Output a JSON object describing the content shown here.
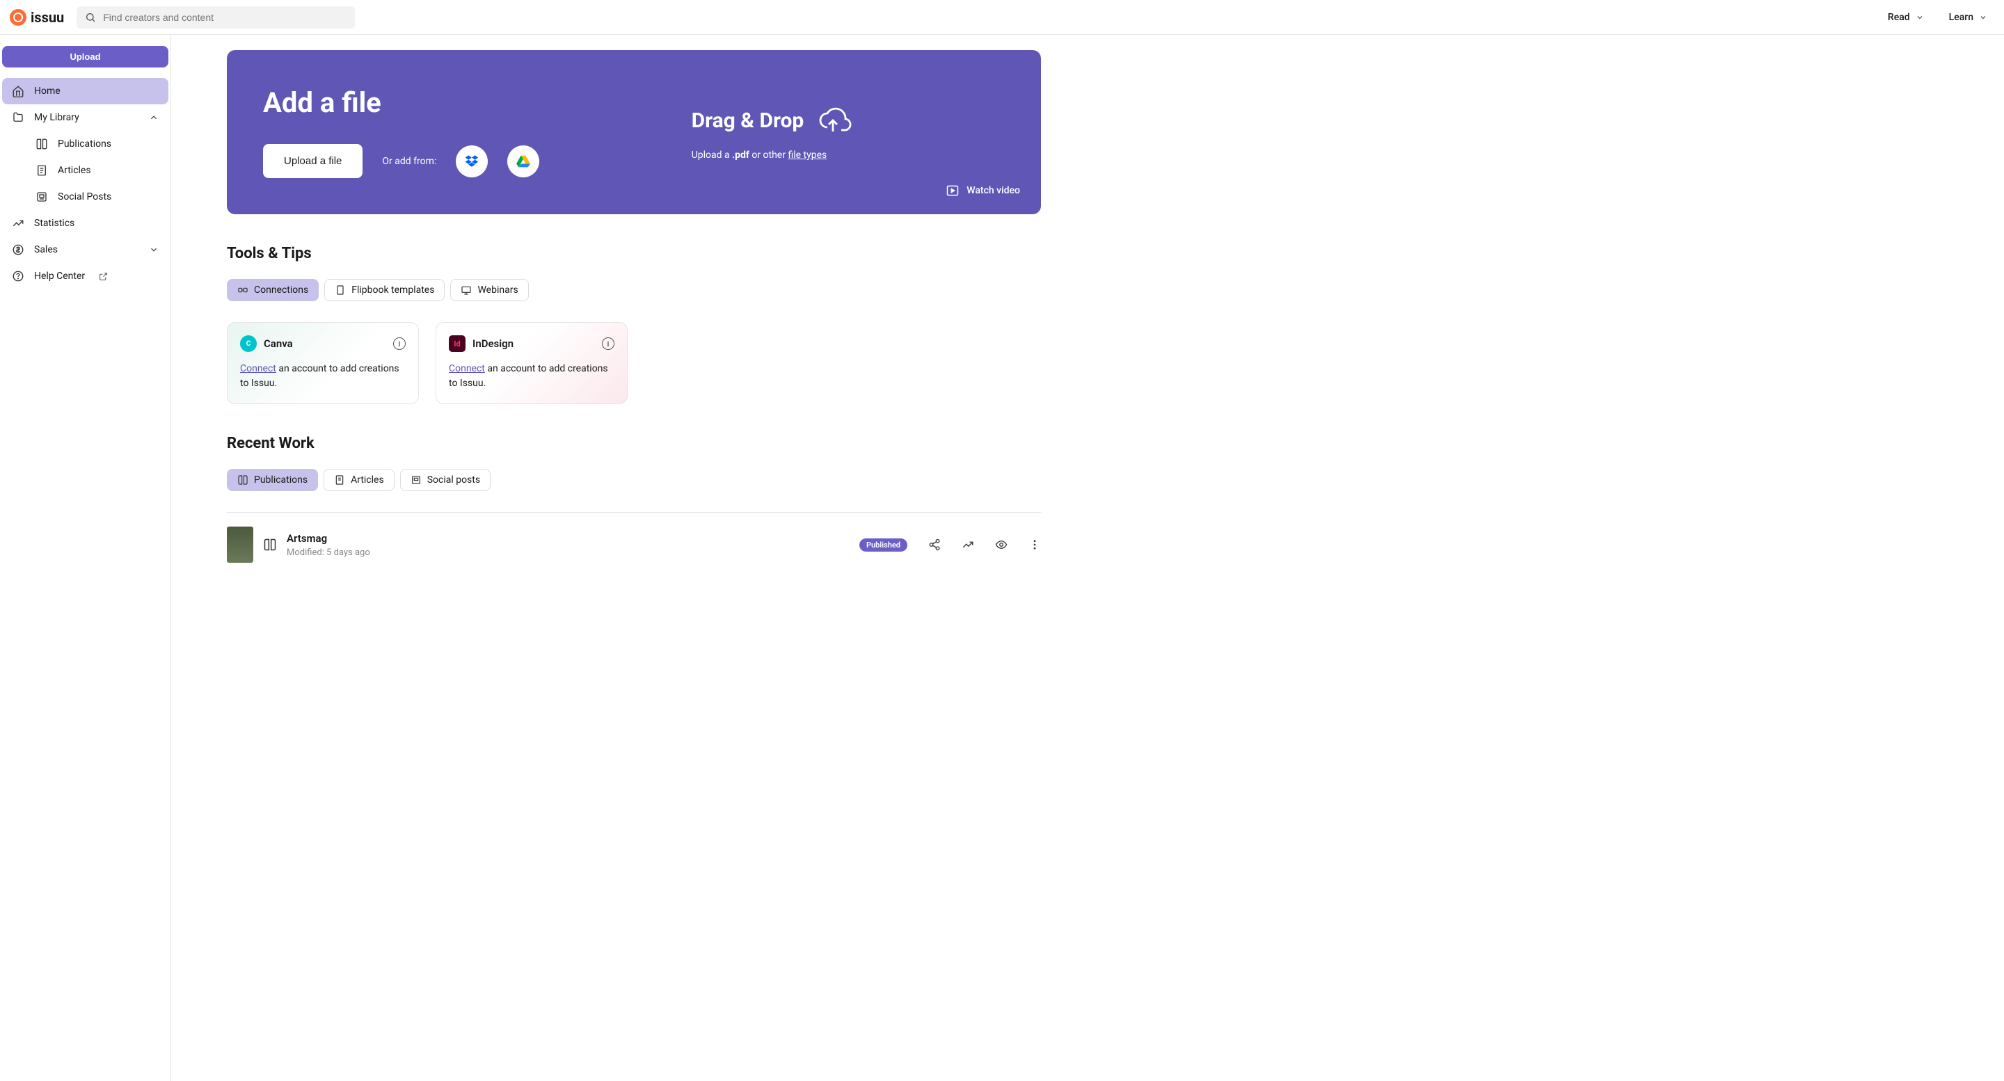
{
  "header": {
    "logo_text": "issuu",
    "search_placeholder": "Find creators and content",
    "read_label": "Read",
    "learn_label": "Learn"
  },
  "sidebar": {
    "upload_label": "Upload",
    "items": [
      {
        "label": "Home",
        "icon": "home"
      },
      {
        "label": "My Library",
        "icon": "folder",
        "expanded": true
      },
      {
        "label": "Publications",
        "icon": "book"
      },
      {
        "label": "Articles",
        "icon": "article"
      },
      {
        "label": "Social Posts",
        "icon": "social"
      },
      {
        "label": "Statistics",
        "icon": "stats"
      },
      {
        "label": "Sales",
        "icon": "sales",
        "expandable": true
      },
      {
        "label": "Help Center",
        "icon": "help",
        "external": true
      }
    ]
  },
  "upload_card": {
    "title": "Add a file",
    "upload_btn": "Upload a file",
    "or_text": "Or add from:",
    "drag_title": "Drag & Drop",
    "hint_prefix": "Upload a ",
    "hint_ext": ".pdf",
    "hint_mid": " or other ",
    "hint_link": "file types",
    "watch_label": "Watch video"
  },
  "tools": {
    "title": "Tools & Tips",
    "tabs": [
      {
        "label": "Connections",
        "icon": "connections"
      },
      {
        "label": "Flipbook templates",
        "icon": "flipbook"
      },
      {
        "label": "Webinars",
        "icon": "webinars"
      }
    ],
    "cards": [
      {
        "name": "Canva",
        "connect": "Connect",
        "desc": " an account to add creations to Issuu."
      },
      {
        "name": "InDesign",
        "connect": "Connect",
        "desc": " an account to add creations to Issuu."
      }
    ]
  },
  "recent": {
    "title": "Recent Work",
    "tabs": [
      {
        "label": "Publications",
        "icon": "book"
      },
      {
        "label": "Articles",
        "icon": "article"
      },
      {
        "label": "Social posts",
        "icon": "social"
      }
    ],
    "items": [
      {
        "title": "Artsmag",
        "meta": "Modified: 5 days ago",
        "badge": "Published"
      }
    ]
  }
}
